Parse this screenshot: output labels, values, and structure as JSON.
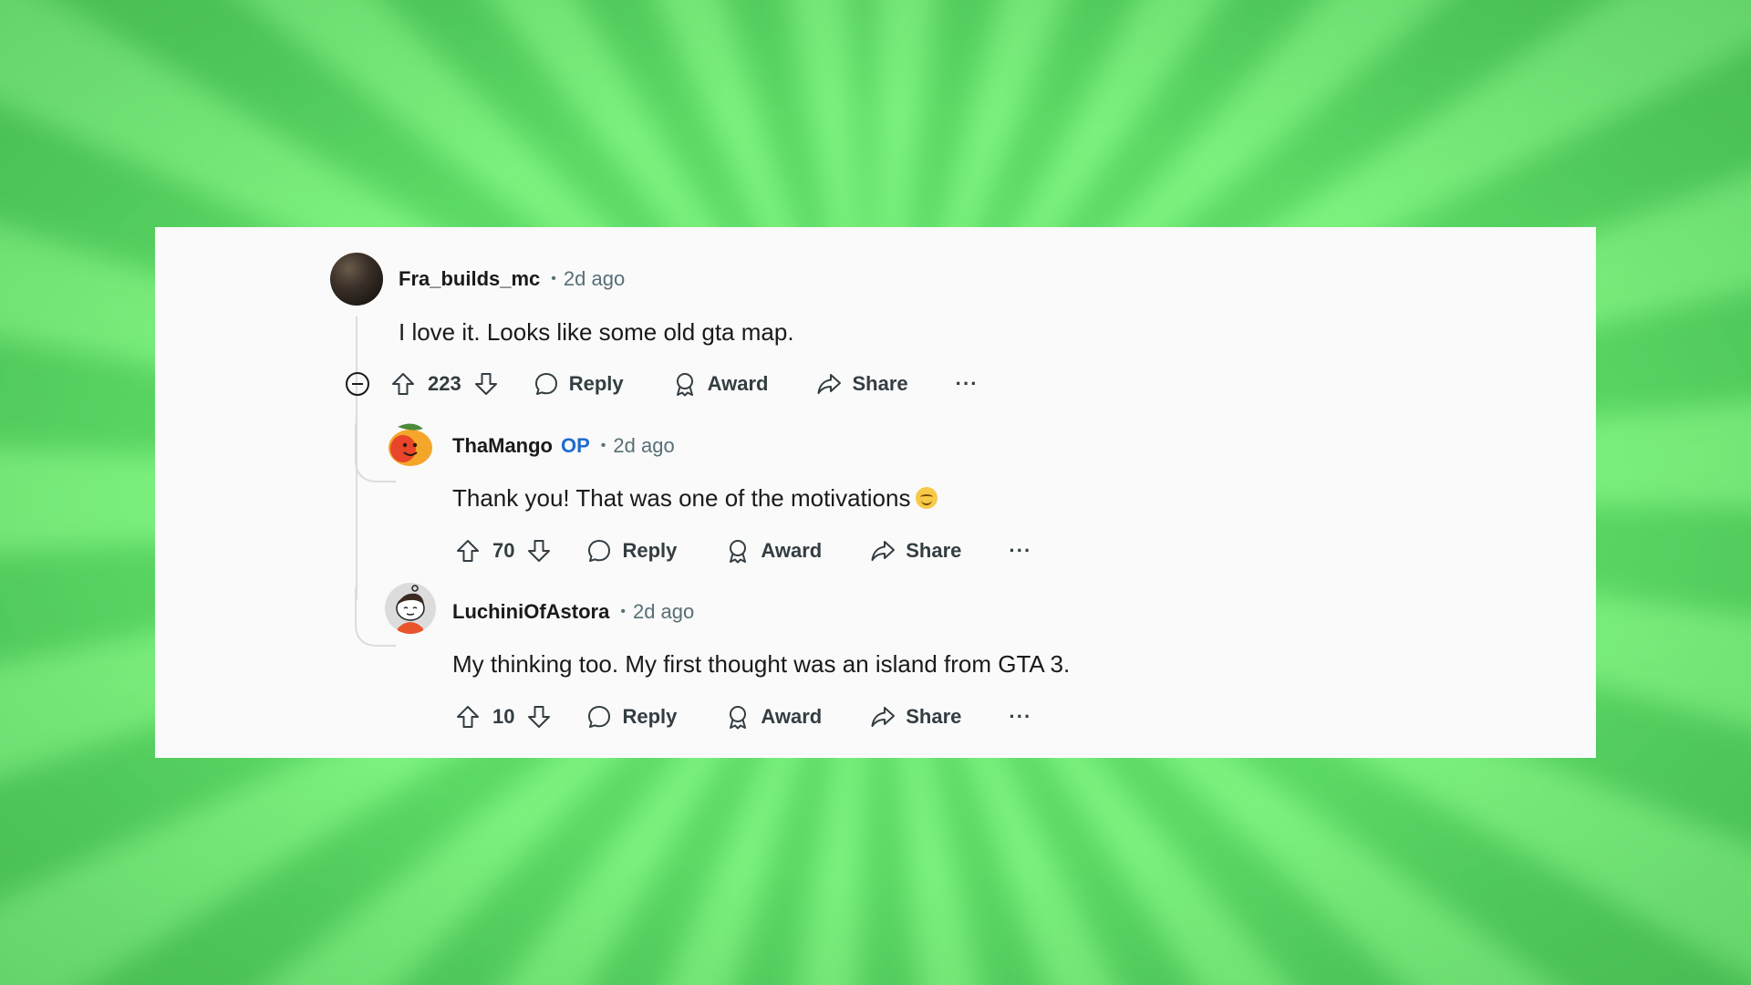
{
  "colors": {
    "background": "#6ee878",
    "card": "#fafafa",
    "text": "#1a1a1b",
    "muted": "#576f76",
    "op": "#1e6bd1"
  },
  "comments": [
    {
      "username": "Fra_builds_mc",
      "op_tag": "",
      "separator": "•",
      "time": "2d ago",
      "body": "I love it. Looks like some old gta map.",
      "score": "223",
      "actions": {
        "reply": "Reply",
        "award": "Award",
        "share": "Share",
        "more": "···"
      },
      "avatar_icon": "dark-photo-avatar"
    },
    {
      "username": "ThaMango",
      "op_tag": "OP",
      "separator": "•",
      "time": "2d ago",
      "body": "Thank you! That was one of the motivations",
      "emoji": "smiling-face-emoji",
      "score": "70",
      "actions": {
        "reply": "Reply",
        "award": "Award",
        "share": "Share",
        "more": "···"
      },
      "avatar_icon": "mango-avatar"
    },
    {
      "username": "LuchiniOfAstora",
      "op_tag": "",
      "separator": "•",
      "time": "2d ago",
      "body": "My thinking too. My first thought was an island from GTA 3.",
      "score": "10",
      "actions": {
        "reply": "Reply",
        "award": "Award",
        "share": "Share",
        "more": "···"
      },
      "avatar_icon": "snoo-avatar"
    }
  ]
}
